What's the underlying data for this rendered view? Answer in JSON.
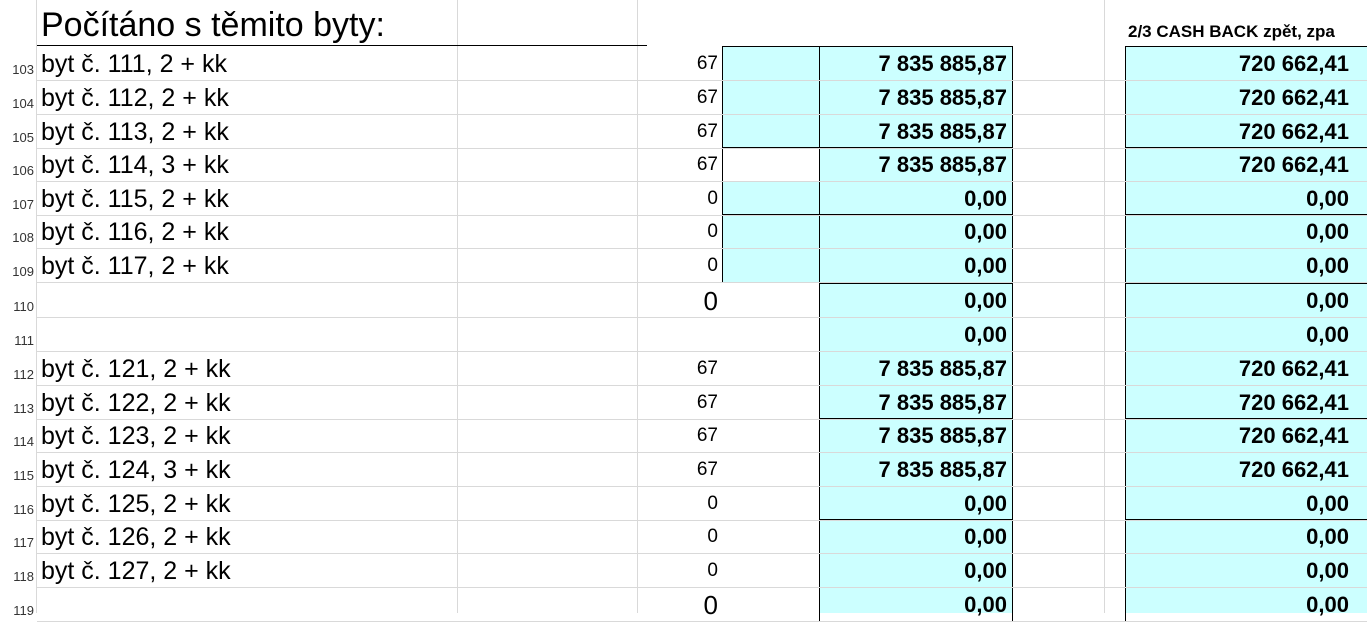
{
  "sheet": {
    "title": "Počítáno s těmito byty:",
    "column_header": "2/3 CASH BACK zpět, zpa",
    "fill_color": "#ccffff",
    "rows": [
      {
        "num": "103",
        "label": "byt č. 111, 2 + kk",
        "count": "67",
        "value": "7 835 885,87",
        "cashback": "720 662,41"
      },
      {
        "num": "104",
        "label": "byt č. 112, 2 + kk",
        "count": "67",
        "value": "7 835 885,87",
        "cashback": "720 662,41"
      },
      {
        "num": "105",
        "label": "byt č. 113, 2 + kk",
        "count": "67",
        "value": "7 835 885,87",
        "cashback": "720 662,41"
      },
      {
        "num": "106",
        "label": "byt č. 114, 3 + kk",
        "count": "67",
        "value": "7 835 885,87",
        "cashback": "720 662,41"
      },
      {
        "num": "107",
        "label": "byt č. 115, 2 + kk",
        "count": "0",
        "value": "0,00",
        "cashback": "0,00"
      },
      {
        "num": "108",
        "label": "byt č. 116, 2 + kk",
        "count": "0",
        "value": "0,00",
        "cashback": "0,00"
      },
      {
        "num": "109",
        "label": "byt č. 117, 2 + kk",
        "count": "0",
        "value": "0,00",
        "cashback": "0,00"
      },
      {
        "num": "110",
        "label": "",
        "count": "0",
        "value": "0,00",
        "cashback": "0,00"
      },
      {
        "num": "111",
        "label": "",
        "count": "",
        "value": "0,00",
        "cashback": "0,00"
      },
      {
        "num": "112",
        "label": "byt č. 121, 2 + kk",
        "count": "67",
        "value": "7 835 885,87",
        "cashback": "720 662,41"
      },
      {
        "num": "113",
        "label": "byt č. 122, 2 + kk",
        "count": "67",
        "value": "7 835 885,87",
        "cashback": "720 662,41"
      },
      {
        "num": "114",
        "label": "byt č. 123, 2 + kk",
        "count": "67",
        "value": "7 835 885,87",
        "cashback": "720 662,41"
      },
      {
        "num": "115",
        "label": "byt č. 124, 3 + kk",
        "count": "67",
        "value": "7 835 885,87",
        "cashback": "720 662,41"
      },
      {
        "num": "116",
        "label": "byt č. 125, 2 + kk",
        "count": "0",
        "value": "0,00",
        "cashback": "0,00"
      },
      {
        "num": "117",
        "label": "byt č. 126, 2 + kk",
        "count": "0",
        "value": "0,00",
        "cashback": "0,00"
      },
      {
        "num": "118",
        "label": "byt č. 127, 2 + kk",
        "count": "0",
        "value": "0,00",
        "cashback": "0,00"
      },
      {
        "num": "119",
        "label": "",
        "count": "0",
        "value": "0,00",
        "cashback": "0,00"
      }
    ]
  }
}
